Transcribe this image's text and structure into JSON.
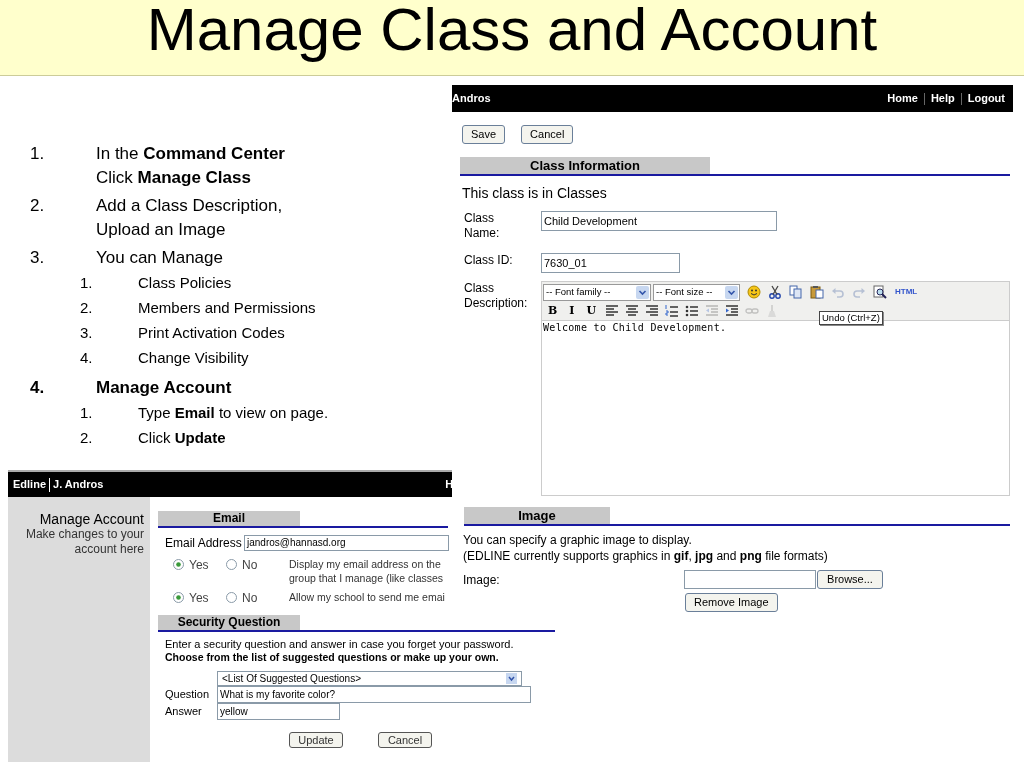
{
  "slide": {
    "title": "Manage Class and Account"
  },
  "steps": [
    {
      "number": "1.",
      "bold": false,
      "lines": [
        "In the **Command Center**",
        "Click **Manage Class**"
      ]
    },
    {
      "number": "2.",
      "bold": false,
      "lines": [
        "Add a Class Description,",
        "Upload an Image"
      ]
    },
    {
      "number": "3.",
      "bold": false,
      "lines": [
        "You can Manage"
      ],
      "children": [
        {
          "number": "1.",
          "text": "Class Policies"
        },
        {
          "number": "2.",
          "text": "Members and Permissions"
        },
        {
          "number": "3.",
          "text": "Print Activation Codes"
        },
        {
          "number": "4.",
          "text": "Change Visibility"
        }
      ]
    },
    {
      "number": "4.",
      "bold": true,
      "lines": [
        "Manage Account"
      ],
      "children": [
        {
          "number": "1.",
          "text": "Type **Email** to view on page."
        },
        {
          "number": "2.",
          "text": "Click **Update**"
        }
      ]
    }
  ],
  "account_window": {
    "header": {
      "brand": "Edline",
      "user": "J. Andros",
      "cut_link": "H"
    },
    "sidebar": {
      "title": "Manage Account",
      "subtitle": "Make changes to your account here"
    },
    "email": {
      "section": "Email",
      "label": "Email Address",
      "value": "jandros@hannasd.org",
      "options": [
        {
          "choices": [
            {
              "label": "Yes",
              "selected": true
            },
            {
              "label": "No",
              "selected": false
            }
          ],
          "lines": [
            "Display my email address on the",
            "group that I manage (like classes"
          ]
        },
        {
          "choices": [
            {
              "label": "Yes",
              "selected": true
            },
            {
              "label": "No",
              "selected": false
            }
          ],
          "lines": [
            "Allow my school to send me emai"
          ]
        }
      ]
    },
    "security": {
      "section": "Security Question",
      "intro": "Enter a security question and answer in case you forget your password.",
      "hint": "Choose from the list of suggested questions or make up your own.",
      "select": "<List Of Suggested Questions>",
      "question_label": "Question",
      "question": "What is my favorite color?",
      "answer_label": "Answer",
      "answer": "yellow",
      "buttons": [
        "Update",
        "Cancel"
      ]
    }
  },
  "class_window": {
    "header": {
      "user": "Andros",
      "links": [
        "Home",
        "Help",
        "Logout"
      ]
    },
    "buttons": [
      "Save",
      "Cancel"
    ],
    "section": "Class Information",
    "location": "This class is in Classes",
    "fields": [
      {
        "label": "Class Name:",
        "value": "Child Development",
        "wide": true
      },
      {
        "label": "Class ID:",
        "value": "7630_01",
        "wide": false
      }
    ],
    "description": {
      "label": "Class Description:",
      "font_family": "-- Font family --",
      "font_size": "-- Font size --",
      "toolbar_1": [
        {
          "kind": "smiley",
          "disabled": false
        },
        {
          "kind": "cut",
          "disabled": false
        },
        {
          "kind": "copy",
          "disabled": false
        },
        {
          "kind": "paste",
          "disabled": false
        },
        {
          "kind": "undo",
          "disabled": true
        },
        {
          "kind": "redo",
          "disabled": true
        },
        {
          "kind": "preview",
          "disabled": false
        },
        {
          "kind": "text",
          "label": "HTML",
          "disabled": false
        }
      ],
      "toolbar_2": [
        {
          "kind": "text",
          "label": "B",
          "disabled": false
        },
        {
          "kind": "text",
          "label": "I",
          "disabled": false
        },
        {
          "kind": "text",
          "label": "U",
          "disabled": false
        },
        {
          "kind": "align-left",
          "disabled": false
        },
        {
          "kind": "align-center",
          "disabled": false
        },
        {
          "kind": "align-right",
          "disabled": false
        },
        {
          "kind": "numbered-list",
          "disabled": false
        },
        {
          "kind": "bullet-list",
          "disabled": false
        },
        {
          "kind": "outdent",
          "disabled": true
        },
        {
          "kind": "indent",
          "disabled": false
        },
        {
          "kind": "link",
          "disabled": true
        },
        {
          "kind": "cleanup",
          "disabled": true
        }
      ],
      "tooltip": "Undo (Ctrl+Z)",
      "text": "Welcome to Child Development."
    },
    "image": {
      "section": "Image",
      "info": [
        "You can specify a graphic image to display.",
        "(EDLINE currently supports graphics in **gif**, **jpg** and **png** file formats)"
      ],
      "label": "Image:",
      "browse": "Browse...",
      "remove": "Remove Image"
    }
  }
}
